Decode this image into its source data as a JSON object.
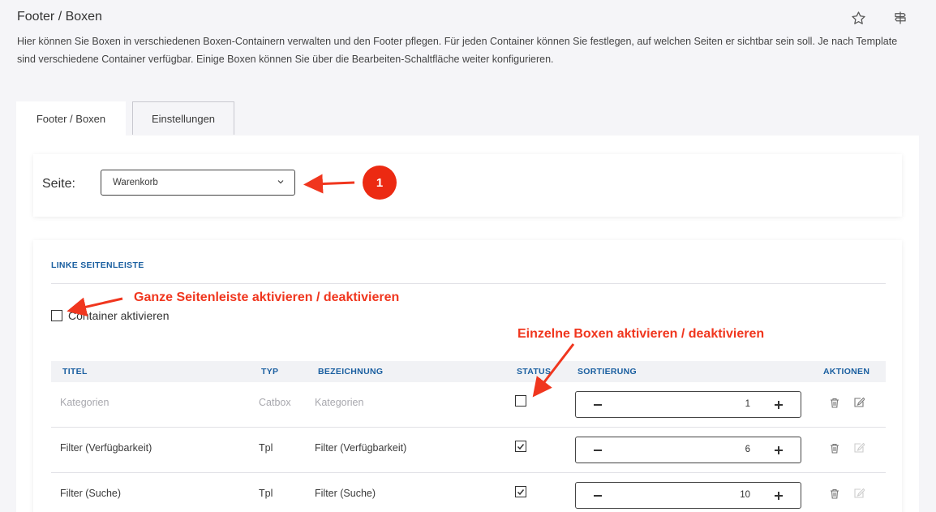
{
  "header": {
    "title": "Footer / Boxen",
    "description": "Hier können Sie Boxen in verschiedenen Boxen-Containern verwalten und den Footer pflegen. Für jeden Container können Sie festlegen, auf welchen Seiten er sichtbar sein soll. Je nach Template sind verschiedene Container verfügbar. Einige Boxen können Sie über die Bearbeiten-Schaltfläche weiter konfigurieren.",
    "icons": [
      "star-icon",
      "signpost-icon"
    ]
  },
  "tabs": [
    {
      "label": "Footer / Boxen",
      "active": true
    },
    {
      "label": "Einstellungen",
      "active": false
    }
  ],
  "page_select": {
    "label": "Seite:",
    "value": "Warenkorb"
  },
  "section": {
    "title": "LINKE SEITENLEISTE",
    "container_label": "Container aktivieren",
    "container_checked": false
  },
  "table": {
    "headers": {
      "title": "TITEL",
      "type": "TYP",
      "name": "BEZEICHNUNG",
      "status": "STATUS",
      "sort": "SORTIERUNG",
      "actions": "AKTIONEN"
    },
    "rows": [
      {
        "title": "Kategorien",
        "type": "Catbox",
        "name": "Kategorien",
        "status": false,
        "sort": "1",
        "muted": true,
        "editable": true
      },
      {
        "title": "Filter (Verfügbarkeit)",
        "type": "Tpl",
        "name": "Filter (Verfügbarkeit)",
        "status": true,
        "sort": "6",
        "muted": false,
        "editable": false
      },
      {
        "title": "Filter (Suche)",
        "type": "Tpl",
        "name": "Filter (Suche)",
        "status": true,
        "sort": "10",
        "muted": false,
        "editable": false
      }
    ]
  },
  "annotations": {
    "badge": "1",
    "sidebar_note": "Ganze Seitenleiste aktivieren / deaktivieren",
    "boxes_note": "Einzelne Boxen aktivieren / deaktivieren"
  },
  "colors": {
    "accent": "#1a5fa0",
    "annotation": "#f0361e",
    "background": "#f5f5f8"
  }
}
